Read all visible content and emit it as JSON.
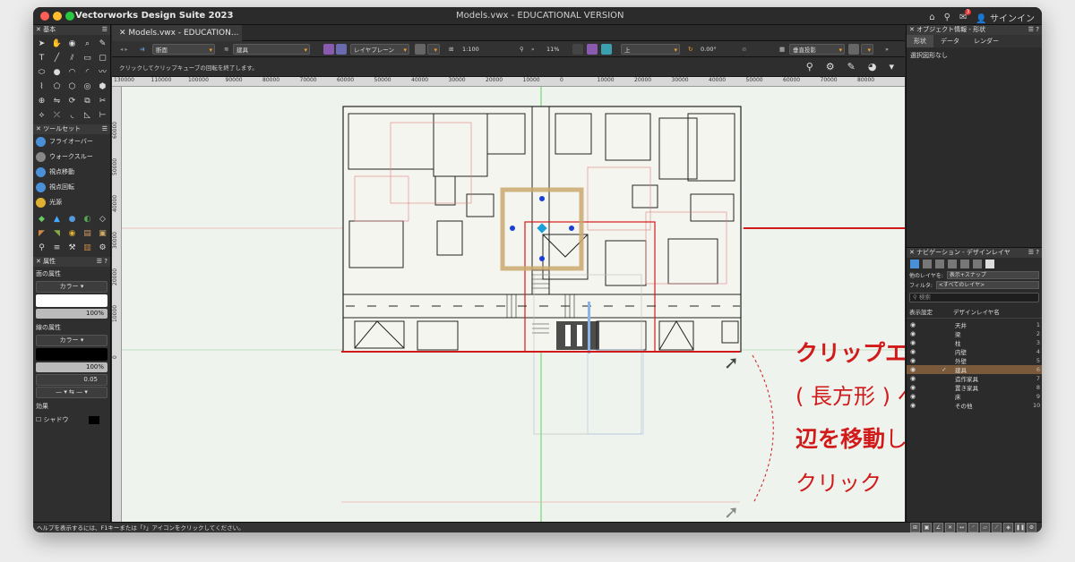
{
  "titlebar": {
    "app_name": "Vectorworks Design Suite 2023",
    "document_title": "Models.vwx - EDUCATIONAL VERSION",
    "signin_label": "サインイン",
    "notification_count": "3"
  },
  "left_panel": {
    "basic_title": "基本",
    "toolset_title": "ツールセット",
    "toolset_items": [
      "フライオーバー",
      "ウォークスルー",
      "視点移動",
      "視点回転",
      "光源"
    ],
    "attributes_title": "属性",
    "fill_label": "面の属性",
    "fill_type": "カラー",
    "fill_opacity": "100%",
    "line_label": "線の属性",
    "line_type": "カラー",
    "line_opacity": "100%",
    "line_weight": "0.05",
    "effects_label": "効果",
    "shadow_label": "シャドウ"
  },
  "doc_tab": {
    "label": "Models.vwx - EDUCATION..."
  },
  "view_bar": {
    "view_mode": "断面",
    "class": "建具",
    "layer_plane": "レイヤプレーン",
    "scale": "1:100",
    "zoom": "11%",
    "view": "上",
    "angle": "0.00°",
    "projection": "垂直投影"
  },
  "mode_bar": {
    "hint": "クリックしてクリップキューブの回転を終了します。"
  },
  "rulers": {
    "h_ticks": [
      "130000",
      "110000",
      "100000",
      "90000",
      "80000",
      "70000",
      "60000",
      "50000",
      "40000",
      "30000",
      "20000",
      "10000",
      "0",
      "10000",
      "20000",
      "30000",
      "40000",
      "50000",
      "60000",
      "70000",
      "80000"
    ],
    "v_ticks": [
      "60000",
      "50000",
      "40000",
      "30000",
      "20000",
      "10000",
      "0"
    ]
  },
  "annotation": {
    "line1": "クリップエリア",
    "line2": "( 長方形 ) へ",
    "line3_bold": "辺を移動",
    "line3_rest": "して",
    "line4": "クリック"
  },
  "right_panel": {
    "obj_info_title": "オブジェクト情報 - 形状",
    "tabs": [
      "形状",
      "データ",
      "レンダー"
    ],
    "no_selection": "選択図形なし",
    "nav_title": "ナビゲーション - デザインレイヤ",
    "other_layers_label": "他のレイヤを:",
    "other_layers_value": "表示+スナップ",
    "filter_label": "フィルタ:",
    "filter_value": "<すべてのレイヤ>",
    "search_placeholder": "検索",
    "col_visibility": "表示設定",
    "col_name": "デザインレイヤ名",
    "layers": [
      {
        "name": "天井",
        "num": "1",
        "active": false
      },
      {
        "name": "梁",
        "num": "2",
        "active": false
      },
      {
        "name": "柱",
        "num": "3",
        "active": false
      },
      {
        "name": "内壁",
        "num": "4",
        "active": false
      },
      {
        "name": "外壁",
        "num": "5",
        "active": false
      },
      {
        "name": "建具",
        "num": "6",
        "active": true
      },
      {
        "name": "造作家具",
        "num": "7",
        "active": false
      },
      {
        "name": "置き家具",
        "num": "8",
        "active": false
      },
      {
        "name": "床",
        "num": "9",
        "active": false
      },
      {
        "name": "その他",
        "num": "10",
        "active": false
      }
    ]
  },
  "status_bar": {
    "help_text": "ヘルプを表示するには、F1キーまたは「?」アイコンをクリックしてください。"
  },
  "colors": {
    "accent_red": "#d11a1a",
    "clip_cube": "#c9a96e",
    "handle_blue": "#1a3fd6"
  }
}
